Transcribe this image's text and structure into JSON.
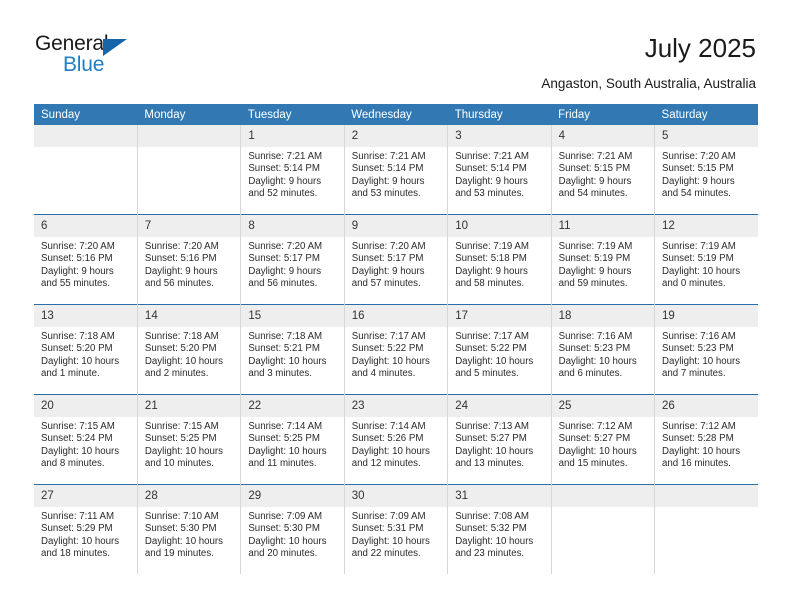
{
  "brand": {
    "name_top": "General",
    "name_bottom": "Blue",
    "accent_color": "#1e7fc4",
    "triangle_color": "#1565a8",
    "triangle_icon": "triangle-icon"
  },
  "header": {
    "title": "July 2025",
    "subtitle": "Angaston, South Australia, Australia",
    "header_bg_color": "#3279b3",
    "daynum_bg_color": "#eeeeee"
  },
  "calendar": {
    "weekday_headers": [
      "Sunday",
      "Monday",
      "Tuesday",
      "Wednesday",
      "Thursday",
      "Friday",
      "Saturday"
    ],
    "labels": {
      "sunrise": "Sunrise:",
      "sunset": "Sunset:",
      "daylight": "Daylight:"
    },
    "weeks": [
      [
        {
          "day": "",
          "blank": true
        },
        {
          "day": "",
          "blank": true
        },
        {
          "day": "1",
          "sunrise": "Sunrise: 7:21 AM",
          "sunset": "Sunset: 5:14 PM",
          "daylight_line1": "Daylight: 9 hours",
          "daylight_line2": "and 52 minutes."
        },
        {
          "day": "2",
          "sunrise": "Sunrise: 7:21 AM",
          "sunset": "Sunset: 5:14 PM",
          "daylight_line1": "Daylight: 9 hours",
          "daylight_line2": "and 53 minutes."
        },
        {
          "day": "3",
          "sunrise": "Sunrise: 7:21 AM",
          "sunset": "Sunset: 5:14 PM",
          "daylight_line1": "Daylight: 9 hours",
          "daylight_line2": "and 53 minutes."
        },
        {
          "day": "4",
          "sunrise": "Sunrise: 7:21 AM",
          "sunset": "Sunset: 5:15 PM",
          "daylight_line1": "Daylight: 9 hours",
          "daylight_line2": "and 54 minutes."
        },
        {
          "day": "5",
          "sunrise": "Sunrise: 7:20 AM",
          "sunset": "Sunset: 5:15 PM",
          "daylight_line1": "Daylight: 9 hours",
          "daylight_line2": "and 54 minutes."
        }
      ],
      [
        {
          "day": "6",
          "sunrise": "Sunrise: 7:20 AM",
          "sunset": "Sunset: 5:16 PM",
          "daylight_line1": "Daylight: 9 hours",
          "daylight_line2": "and 55 minutes."
        },
        {
          "day": "7",
          "sunrise": "Sunrise: 7:20 AM",
          "sunset": "Sunset: 5:16 PM",
          "daylight_line1": "Daylight: 9 hours",
          "daylight_line2": "and 56 minutes."
        },
        {
          "day": "8",
          "sunrise": "Sunrise: 7:20 AM",
          "sunset": "Sunset: 5:17 PM",
          "daylight_line1": "Daylight: 9 hours",
          "daylight_line2": "and 56 minutes."
        },
        {
          "day": "9",
          "sunrise": "Sunrise: 7:20 AM",
          "sunset": "Sunset: 5:17 PM",
          "daylight_line1": "Daylight: 9 hours",
          "daylight_line2": "and 57 minutes."
        },
        {
          "day": "10",
          "sunrise": "Sunrise: 7:19 AM",
          "sunset": "Sunset: 5:18 PM",
          "daylight_line1": "Daylight: 9 hours",
          "daylight_line2": "and 58 minutes."
        },
        {
          "day": "11",
          "sunrise": "Sunrise: 7:19 AM",
          "sunset": "Sunset: 5:19 PM",
          "daylight_line1": "Daylight: 9 hours",
          "daylight_line2": "and 59 minutes."
        },
        {
          "day": "12",
          "sunrise": "Sunrise: 7:19 AM",
          "sunset": "Sunset: 5:19 PM",
          "daylight_line1": "Daylight: 10 hours",
          "daylight_line2": "and 0 minutes."
        }
      ],
      [
        {
          "day": "13",
          "sunrise": "Sunrise: 7:18 AM",
          "sunset": "Sunset: 5:20 PM",
          "daylight_line1": "Daylight: 10 hours",
          "daylight_line2": "and 1 minute."
        },
        {
          "day": "14",
          "sunrise": "Sunrise: 7:18 AM",
          "sunset": "Sunset: 5:20 PM",
          "daylight_line1": "Daylight: 10 hours",
          "daylight_line2": "and 2 minutes."
        },
        {
          "day": "15",
          "sunrise": "Sunrise: 7:18 AM",
          "sunset": "Sunset: 5:21 PM",
          "daylight_line1": "Daylight: 10 hours",
          "daylight_line2": "and 3 minutes."
        },
        {
          "day": "16",
          "sunrise": "Sunrise: 7:17 AM",
          "sunset": "Sunset: 5:22 PM",
          "daylight_line1": "Daylight: 10 hours",
          "daylight_line2": "and 4 minutes."
        },
        {
          "day": "17",
          "sunrise": "Sunrise: 7:17 AM",
          "sunset": "Sunset: 5:22 PM",
          "daylight_line1": "Daylight: 10 hours",
          "daylight_line2": "and 5 minutes."
        },
        {
          "day": "18",
          "sunrise": "Sunrise: 7:16 AM",
          "sunset": "Sunset: 5:23 PM",
          "daylight_line1": "Daylight: 10 hours",
          "daylight_line2": "and 6 minutes."
        },
        {
          "day": "19",
          "sunrise": "Sunrise: 7:16 AM",
          "sunset": "Sunset: 5:23 PM",
          "daylight_line1": "Daylight: 10 hours",
          "daylight_line2": "and 7 minutes."
        }
      ],
      [
        {
          "day": "20",
          "sunrise": "Sunrise: 7:15 AM",
          "sunset": "Sunset: 5:24 PM",
          "daylight_line1": "Daylight: 10 hours",
          "daylight_line2": "and 8 minutes."
        },
        {
          "day": "21",
          "sunrise": "Sunrise: 7:15 AM",
          "sunset": "Sunset: 5:25 PM",
          "daylight_line1": "Daylight: 10 hours",
          "daylight_line2": "and 10 minutes."
        },
        {
          "day": "22",
          "sunrise": "Sunrise: 7:14 AM",
          "sunset": "Sunset: 5:25 PM",
          "daylight_line1": "Daylight: 10 hours",
          "daylight_line2": "and 11 minutes."
        },
        {
          "day": "23",
          "sunrise": "Sunrise: 7:14 AM",
          "sunset": "Sunset: 5:26 PM",
          "daylight_line1": "Daylight: 10 hours",
          "daylight_line2": "and 12 minutes."
        },
        {
          "day": "24",
          "sunrise": "Sunrise: 7:13 AM",
          "sunset": "Sunset: 5:27 PM",
          "daylight_line1": "Daylight: 10 hours",
          "daylight_line2": "and 13 minutes."
        },
        {
          "day": "25",
          "sunrise": "Sunrise: 7:12 AM",
          "sunset": "Sunset: 5:27 PM",
          "daylight_line1": "Daylight: 10 hours",
          "daylight_line2": "and 15 minutes."
        },
        {
          "day": "26",
          "sunrise": "Sunrise: 7:12 AM",
          "sunset": "Sunset: 5:28 PM",
          "daylight_line1": "Daylight: 10 hours",
          "daylight_line2": "and 16 minutes."
        }
      ],
      [
        {
          "day": "27",
          "sunrise": "Sunrise: 7:11 AM",
          "sunset": "Sunset: 5:29 PM",
          "daylight_line1": "Daylight: 10 hours",
          "daylight_line2": "and 18 minutes."
        },
        {
          "day": "28",
          "sunrise": "Sunrise: 7:10 AM",
          "sunset": "Sunset: 5:30 PM",
          "daylight_line1": "Daylight: 10 hours",
          "daylight_line2": "and 19 minutes."
        },
        {
          "day": "29",
          "sunrise": "Sunrise: 7:09 AM",
          "sunset": "Sunset: 5:30 PM",
          "daylight_line1": "Daylight: 10 hours",
          "daylight_line2": "and 20 minutes."
        },
        {
          "day": "30",
          "sunrise": "Sunrise: 7:09 AM",
          "sunset": "Sunset: 5:31 PM",
          "daylight_line1": "Daylight: 10 hours",
          "daylight_line2": "and 22 minutes."
        },
        {
          "day": "31",
          "sunrise": "Sunrise: 7:08 AM",
          "sunset": "Sunset: 5:32 PM",
          "daylight_line1": "Daylight: 10 hours",
          "daylight_line2": "and 23 minutes."
        },
        {
          "day": "",
          "blank": true
        },
        {
          "day": "",
          "blank": true
        }
      ]
    ]
  }
}
